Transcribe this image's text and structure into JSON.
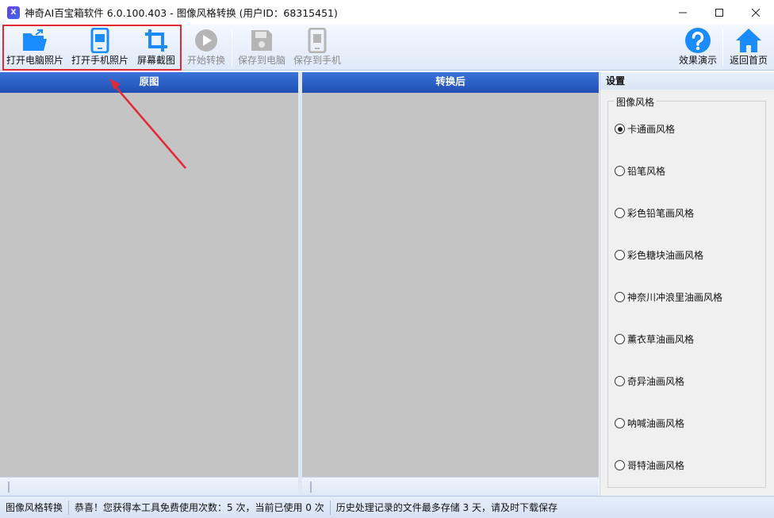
{
  "window": {
    "title": "神奇AI百宝箱软件 6.0.100.403 - 图像风格转换 (用户ID：68315451)",
    "icon_text": "X"
  },
  "toolbar": {
    "open_pc_photo": "打开电脑照片",
    "open_phone_photo": "打开手机照片",
    "screenshot": "屏幕截图",
    "start_convert": "开始转换",
    "save_to_pc": "保存到电脑",
    "save_to_phone": "保存到手机",
    "demo": "效果演示",
    "home": "返回首页"
  },
  "panels": {
    "original": "原图",
    "converted": "转换后"
  },
  "settings": {
    "title": "设置",
    "group_label": "图像风格",
    "styles": [
      {
        "label": "卡通画风格",
        "checked": true
      },
      {
        "label": "铅笔风格",
        "checked": false
      },
      {
        "label": "彩色铅笔画风格",
        "checked": false
      },
      {
        "label": "彩色糖块油画风格",
        "checked": false
      },
      {
        "label": "神奈川冲浪里油画风格",
        "checked": false
      },
      {
        "label": "薰衣草油画风格",
        "checked": false
      },
      {
        "label": "奇异油画风格",
        "checked": false
      },
      {
        "label": "呐喊油画风格",
        "checked": false
      },
      {
        "label": "哥特油画风格",
        "checked": false
      }
    ]
  },
  "status": {
    "module": "图像风格转换",
    "usage": "恭喜！您获得本工具免费使用次数：5 次，当前已使用 0 次",
    "storage": "历史处理记录的文件最多存储 3 天，请及时下载保存"
  },
  "colors": {
    "accent": "#1a8cff",
    "header_blue": "#2a5fc4",
    "highlight_red": "#e02a35"
  }
}
